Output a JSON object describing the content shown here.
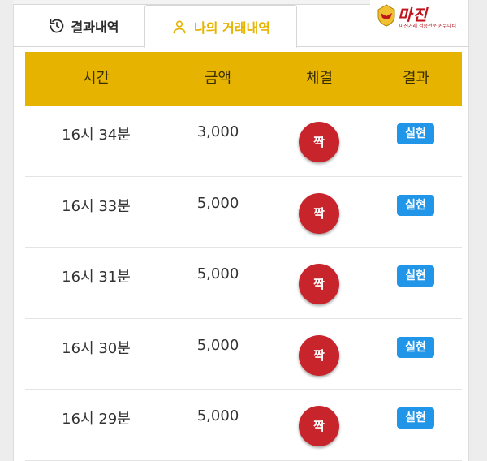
{
  "tabs": [
    {
      "label": "결과내역",
      "icon": "history-icon",
      "active": false
    },
    {
      "label": "나의 거래내역",
      "icon": "user-icon",
      "active": true
    }
  ],
  "logo": {
    "text": "마진",
    "subtext": "마진거래 검증전문 커뮤니티",
    "icon": "eagle-badge-icon"
  },
  "colors": {
    "accent": "#e6b400",
    "bet_red": "#c8242b",
    "result_blue": "#2196e8"
  },
  "table": {
    "headers": [
      "시간",
      "금액",
      "체결",
      "결과"
    ],
    "rows": [
      {
        "time": "16시 34분",
        "amount": "3,000",
        "bet": "짝",
        "result": "실현"
      },
      {
        "time": "16시 33분",
        "amount": "5,000",
        "bet": "짝",
        "result": "실현"
      },
      {
        "time": "16시 31분",
        "amount": "5,000",
        "bet": "짝",
        "result": "실현"
      },
      {
        "time": "16시 30분",
        "amount": "5,000",
        "bet": "짝",
        "result": "실현"
      },
      {
        "time": "16시 29분",
        "amount": "5,000",
        "bet": "짝",
        "result": "실현"
      }
    ]
  }
}
